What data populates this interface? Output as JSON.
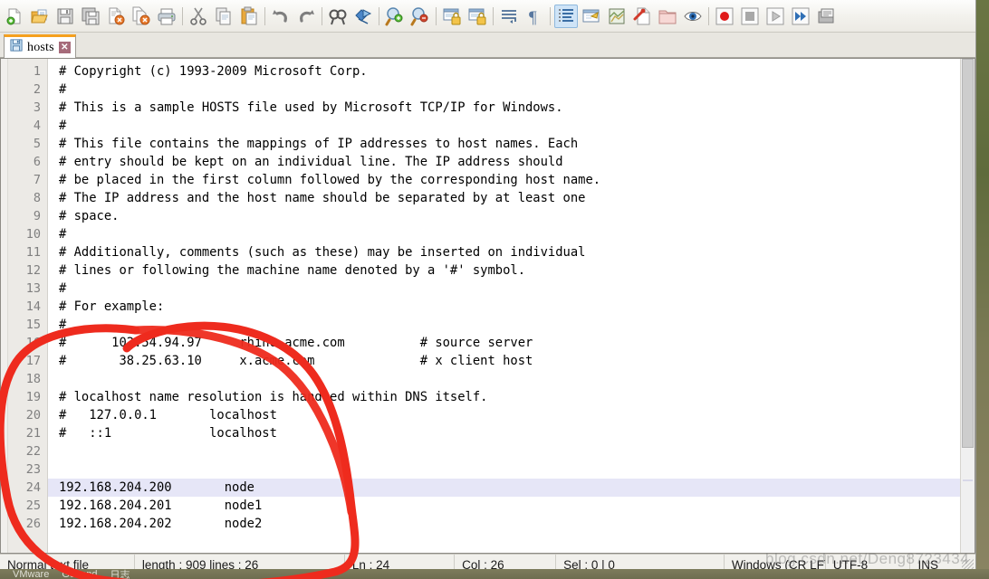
{
  "app": {
    "name": "Notepad++",
    "accent_orange": "#f5a01e",
    "current_line_highlight": "#e6e6f7",
    "annotation_color": "#ee2b1e"
  },
  "toolbar": {
    "groups": [
      {
        "buttons": [
          {
            "icon": "new-file-icon",
            "label": "New"
          },
          {
            "icon": "open-file-icon",
            "label": "Open"
          },
          {
            "icon": "save-icon",
            "label": "Save"
          },
          {
            "icon": "save-all-icon",
            "label": "Save All"
          },
          {
            "icon": "close-file-icon",
            "label": "Close"
          },
          {
            "icon": "close-all-icon",
            "label": "Close All"
          },
          {
            "icon": "print-icon",
            "label": "Print"
          }
        ]
      },
      {
        "buttons": [
          {
            "icon": "cut-icon",
            "label": "Cut"
          },
          {
            "icon": "copy-icon",
            "label": "Copy"
          },
          {
            "icon": "paste-icon",
            "label": "Paste"
          }
        ]
      },
      {
        "buttons": [
          {
            "icon": "undo-icon",
            "label": "Undo"
          },
          {
            "icon": "redo-icon",
            "label": "Redo"
          }
        ]
      },
      {
        "buttons": [
          {
            "icon": "find-icon",
            "label": "Find"
          },
          {
            "icon": "replace-icon",
            "label": "Replace"
          }
        ]
      },
      {
        "buttons": [
          {
            "icon": "zoom-in-icon",
            "label": "Zoom In"
          },
          {
            "icon": "zoom-out-icon",
            "label": "Zoom Out"
          }
        ]
      },
      {
        "buttons": [
          {
            "icon": "sync-vertical-scroll-icon",
            "label": "Synchronize Vertical Scrolling"
          },
          {
            "icon": "sync-horizontal-scroll-icon",
            "label": "Synchronize Horizontal Scrolling"
          }
        ]
      },
      {
        "buttons": [
          {
            "icon": "word-wrap-icon",
            "label": "Word wrap"
          },
          {
            "icon": "show-all-characters-icon",
            "label": "Show All Characters"
          }
        ]
      },
      {
        "buttons": [
          {
            "icon": "indent-guideline-icon",
            "label": "Show Indent Guide",
            "active": true
          },
          {
            "icon": "user-defined-dialog-icon",
            "label": "User-Defined Dialogue"
          },
          {
            "icon": "document-map-icon",
            "label": "Document Map"
          },
          {
            "icon": "function-list-icon",
            "label": "Function List"
          },
          {
            "icon": "folder-as-workspace-icon",
            "label": "Folder as Workspace"
          },
          {
            "icon": "monitoring-icon",
            "label": "Monitoring"
          }
        ]
      },
      {
        "buttons": [
          {
            "icon": "record-macro-icon",
            "label": "Start Recording"
          },
          {
            "icon": "stop-macro-icon",
            "label": "Stop Recording"
          },
          {
            "icon": "play-macro-icon",
            "label": "Playback"
          },
          {
            "icon": "run-macro-multiple-icon",
            "label": "Run a Macro Multiple Times"
          },
          {
            "icon": "run-icon",
            "label": "Run"
          }
        ]
      }
    ]
  },
  "tabs": [
    {
      "label": "hosts",
      "icon": "saved-file-icon",
      "close": "✕",
      "active": true
    }
  ],
  "editor": {
    "current_line": 24,
    "lines": [
      {
        "n": 1,
        "text": "# Copyright (c) 1993-2009 Microsoft Corp."
      },
      {
        "n": 2,
        "text": "#"
      },
      {
        "n": 3,
        "text": "# This is a sample HOSTS file used by Microsoft TCP/IP for Windows."
      },
      {
        "n": 4,
        "text": "#"
      },
      {
        "n": 5,
        "text": "# This file contains the mappings of IP addresses to host names. Each"
      },
      {
        "n": 6,
        "text": "# entry should be kept on an individual line. The IP address should"
      },
      {
        "n": 7,
        "text": "# be placed in the first column followed by the corresponding host name."
      },
      {
        "n": 8,
        "text": "# The IP address and the host name should be separated by at least one"
      },
      {
        "n": 9,
        "text": "# space."
      },
      {
        "n": 10,
        "text": "#"
      },
      {
        "n": 11,
        "text": "# Additionally, comments (such as these) may be inserted on individual"
      },
      {
        "n": 12,
        "text": "# lines or following the machine name denoted by a '#' symbol."
      },
      {
        "n": 13,
        "text": "#"
      },
      {
        "n": 14,
        "text": "# For example:"
      },
      {
        "n": 15,
        "text": "#"
      },
      {
        "n": 16,
        "text": "#      102.54.94.97     rhino.acme.com          # source server"
      },
      {
        "n": 17,
        "text": "#       38.25.63.10     x.acme.com              # x client host"
      },
      {
        "n": 18,
        "text": ""
      },
      {
        "n": 19,
        "text": "# localhost name resolution is handled within DNS itself."
      },
      {
        "n": 20,
        "text": "#   127.0.0.1       localhost"
      },
      {
        "n": 21,
        "text": "#   ::1             localhost"
      },
      {
        "n": 22,
        "text": ""
      },
      {
        "n": 23,
        "text": ""
      },
      {
        "n": 24,
        "text": "192.168.204.200       node"
      },
      {
        "n": 25,
        "text": "192.168.204.201       node1"
      },
      {
        "n": 26,
        "text": "192.168.204.202       node2"
      }
    ]
  },
  "statusbar": {
    "file_type": "Normal text file",
    "length_lines": "length : 909   lines : 26",
    "ln": "Ln : 24",
    "col": "Col : 26",
    "sel": "Sel : 0 | 0",
    "eol": "Windows (CR LF)",
    "encoding": "UTF-8",
    "insert_mode": "INS"
  },
  "taskbar": {
    "items": [
      "VMware",
      "GoLand",
      "日志"
    ]
  },
  "watermark": {
    "text": "blog.csdn.net/Deng8723434"
  }
}
